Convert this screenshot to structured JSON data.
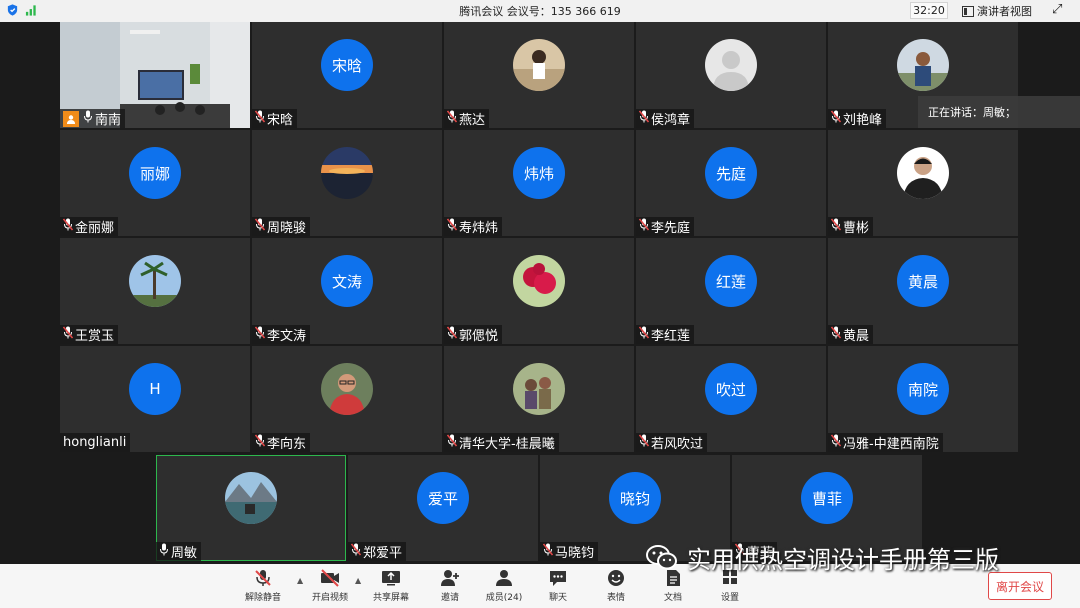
{
  "titlebar": {
    "title": "腾讯会议 会议号：135 366 619",
    "time": "32:20",
    "view_label": "演讲者视图"
  },
  "speaking_banner": "正在讲话：周敏；",
  "tiles": [
    {
      "name": "南南",
      "type": "video"
    },
    {
      "name": "宋晗",
      "type": "avatar",
      "avatar_text": "宋晗"
    },
    {
      "name": "燕达",
      "type": "photo",
      "photo": "girl-photo"
    },
    {
      "name": "侯鸿章",
      "type": "photo",
      "photo": "default-user-photo"
    },
    {
      "name": "刘艳峰",
      "type": "photo",
      "photo": "man-outdoor-photo"
    },
    {
      "name": "金丽娜",
      "type": "avatar",
      "avatar_text": "丽娜"
    },
    {
      "name": "周晓骏",
      "type": "photo",
      "photo": "sunset-photo"
    },
    {
      "name": "寿炜炜",
      "type": "avatar",
      "avatar_text": "炜炜"
    },
    {
      "name": "李先庭",
      "type": "avatar",
      "avatar_text": "先庭"
    },
    {
      "name": "曹彬",
      "type": "photo",
      "photo": "man-portrait-photo"
    },
    {
      "name": "王赏玉",
      "type": "photo",
      "photo": "palm-tree-photo"
    },
    {
      "name": "李文涛",
      "type": "avatar",
      "avatar_text": "文涛"
    },
    {
      "name": "郭偲悦",
      "type": "photo",
      "photo": "raspberry-photo"
    },
    {
      "name": "李红莲",
      "type": "avatar",
      "avatar_text": "红莲"
    },
    {
      "name": "黄晨",
      "type": "avatar",
      "avatar_text": "黄晨"
    },
    {
      "name": "honglianli",
      "type": "avatar",
      "avatar_text": "H"
    },
    {
      "name": "李向东",
      "type": "photo",
      "photo": "man-glasses-photo"
    },
    {
      "name": "清华大学-桂晨曦",
      "type": "photo",
      "photo": "family-photo"
    },
    {
      "name": "若风吹过",
      "type": "avatar",
      "avatar_text": "吹过"
    },
    {
      "name": "冯雅-中建西南院",
      "type": "avatar",
      "avatar_text": "南院"
    },
    {
      "name": "周敏",
      "type": "photo",
      "photo": "mountain-lake-photo",
      "active": true
    },
    {
      "name": "郑爱平",
      "type": "avatar",
      "avatar_text": "爱平"
    },
    {
      "name": "马晓钧",
      "type": "avatar",
      "avatar_text": "晓钧"
    },
    {
      "name": "曹菲",
      "type": "avatar",
      "avatar_text": "曹菲"
    }
  ],
  "toolbar": {
    "unmute": "解除静音",
    "start_video": "开启视频",
    "share_screen": "共享屏幕",
    "invite": "邀请",
    "members": "成员(24)",
    "chat": "聊天",
    "reactions": "表情",
    "docs": "文档",
    "settings": "设置",
    "leave": "离开会议"
  },
  "watermark": "实用供热空调设计手册第三版",
  "colors": {
    "accent": "#0e72ed",
    "leave": "#e04848",
    "active_border": "#2db84d"
  }
}
